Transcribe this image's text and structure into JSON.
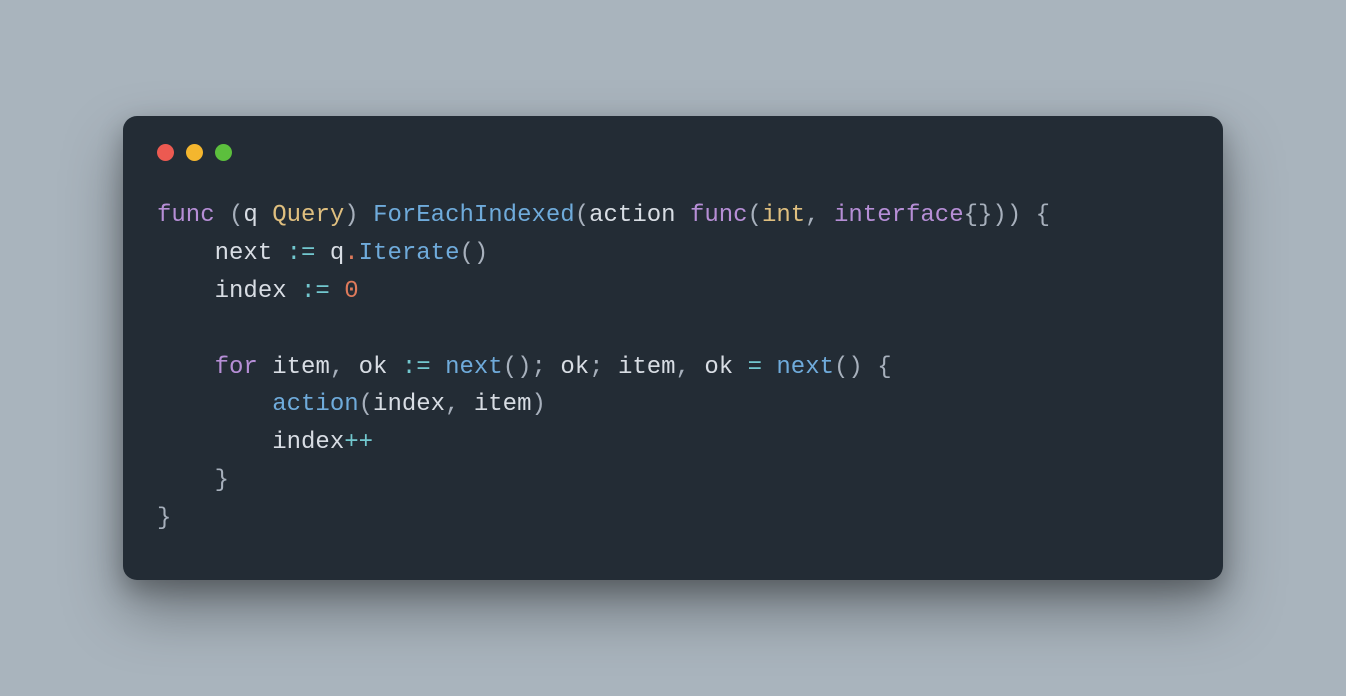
{
  "traffic_lights": {
    "red": "#ec5a51",
    "yellow": "#f4b62e",
    "green": "#5cbf3d"
  },
  "code": {
    "kw_func": "func",
    "lparen1": "(",
    "recv_name": "q",
    "space": " ",
    "recv_type": "Query",
    "rparen1": ")",
    "method": "ForEachIndexed",
    "lparen2": "(",
    "param1": "action",
    "kw_func2": "func",
    "lparen3": "(",
    "t_int": "int",
    "comma1": ",",
    "kw_interface": "interface",
    "braces_empty": "{}",
    "rparen3": ")",
    "rparen2": ")",
    "lbrace": "{",
    "next_var": "next",
    "walrus": ":=",
    "q_ident": "q",
    "dot": ".",
    "iterate": "Iterate",
    "call_parens": "()",
    "index_var": "index",
    "zero": "0",
    "kw_for": "for",
    "item": "item",
    "ok": "ok",
    "next_call": "next",
    "semi": ";",
    "eq": "=",
    "action_call": "action",
    "comma2": ",",
    "plusplus": "++",
    "rbrace": "}"
  }
}
